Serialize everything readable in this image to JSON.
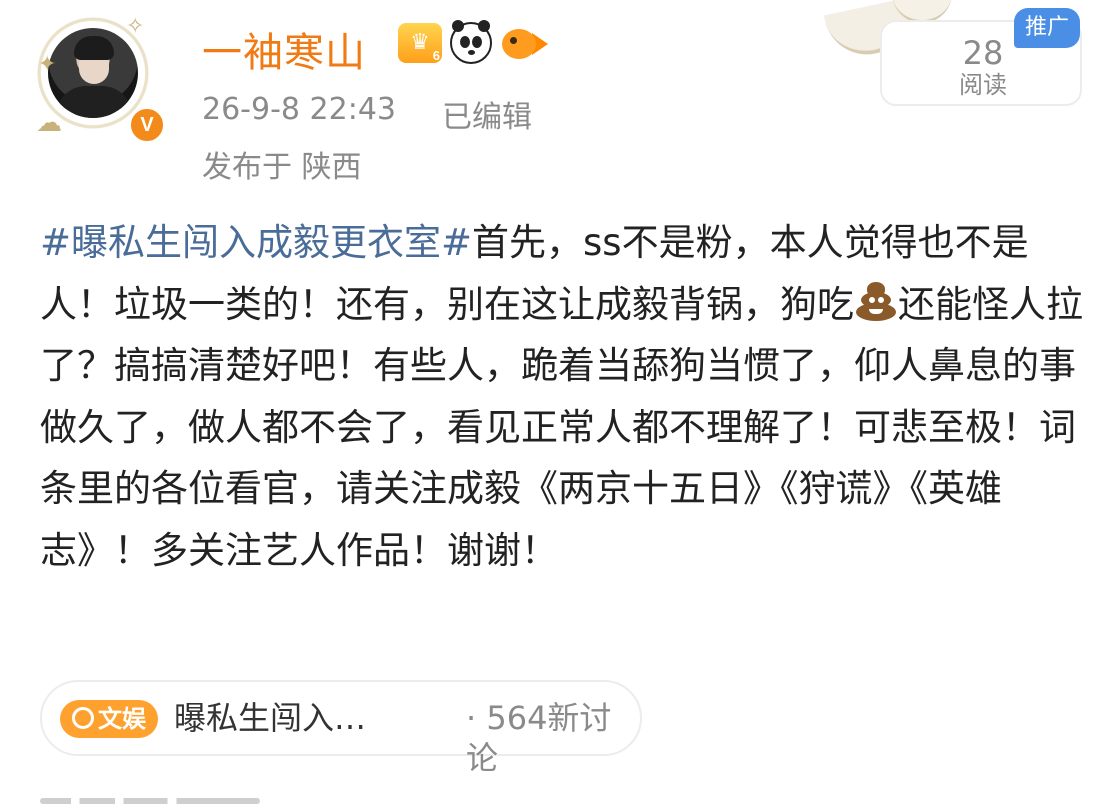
{
  "user": {
    "name": "一袖寒山",
    "timestamp": "26-9-8 22:43",
    "edited": "已编辑",
    "location": "发布于 陕西",
    "badge_level": "6",
    "verified_mark": "V"
  },
  "stats": {
    "read_count": "28",
    "read_label": "阅读"
  },
  "promo_label": "推广",
  "post": {
    "hashtag": "#曝私生闯入成毅更衣室#",
    "text_part1": "首先，ss不是粉，本人觉得也不是人！垃圾一类的！还有，别在这让成毅背锅，狗吃",
    "emoji_name": "poop-emoji",
    "text_part2": "还能怪人拉了？搞搞清楚好吧！有些人，跪着当舔狗当惯了，仰人鼻息的事做久了，做人都不会了，看见正常人都不理解了！可悲至极！词条里的各位看官，请关注成毅《两京十五日》《狩谎》《英雄志》！多关注艺人作品！谢谢！"
  },
  "topic": {
    "tag_label": "文娱",
    "title": "曝私生闯入…",
    "count": "· 564新讨论"
  },
  "colors": {
    "username": "#f07a13",
    "hashtag": "#4a6c98",
    "meta_gray": "#8a8a8a",
    "promo_blue": "#4b8ee6",
    "topic_orange": "#ffa12e"
  }
}
